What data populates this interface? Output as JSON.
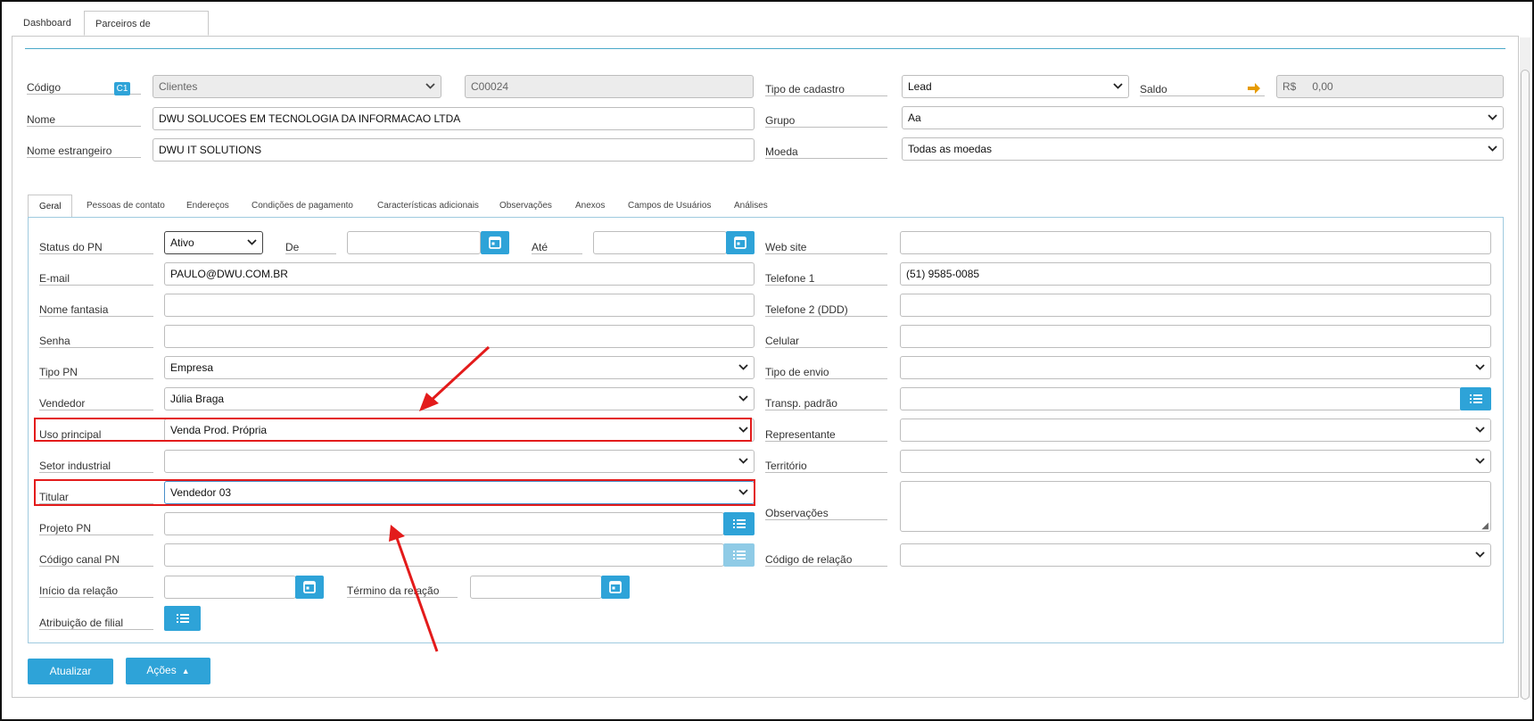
{
  "tabs": {
    "dashboard": "Dashboard",
    "partners": "Parceiros de negócios"
  },
  "header": {
    "codigo_label": "Código",
    "codigo_badge": "C1",
    "codigo_type": "Clientes",
    "codigo_value": "C00024",
    "nome_label": "Nome",
    "nome_value": "DWU SOLUCOES EM TECNOLOGIA DA INFORMACAO LTDA",
    "nome_estrangeiro_label": "Nome estrangeiro",
    "nome_estrangeiro_value": "DWU IT SOLUTIONS",
    "tipo_cadastro_label": "Tipo de cadastro",
    "tipo_cadastro_value": "Lead",
    "saldo_label": "Saldo",
    "saldo_currency": "R$",
    "saldo_value": "0,00",
    "grupo_label": "Grupo",
    "grupo_value": "Aa",
    "moeda_label": "Moeda",
    "moeda_value": "Todas as moedas"
  },
  "page_tabs": [
    "Geral",
    "Pessoas de contato",
    "Endereços",
    "Condições de pagamento",
    "Características adicionais",
    "Observações",
    "Anexos",
    "Campos de Usuários",
    "Análises"
  ],
  "form": {
    "status_label": "Status do PN",
    "status_value": "Ativo",
    "de_label": "De",
    "ate_label": "Até",
    "email_label": "E-mail",
    "email_value": "PAULO@DWU.COM.BR",
    "nome_fantasia_label": "Nome fantasia",
    "senha_label": "Senha",
    "tipo_pn_label": "Tipo PN",
    "tipo_pn_value": "Empresa",
    "vendedor_label": "Vendedor",
    "vendedor_value": "Júlia Braga",
    "uso_principal_label": "Uso principal",
    "uso_principal_value": "Venda Prod. Própria",
    "setor_label": "Setor industrial",
    "titular_label": "Titular",
    "titular_value": "Vendedor 03",
    "projeto_label": "Projeto PN",
    "canal_label": "Código canal PN",
    "inicio_label": "Início da relação",
    "termino_label": "Término da relação",
    "filial_label": "Atribuição de filial",
    "website_label": "Web site",
    "telefone1_label": "Telefone 1",
    "telefone1_value": "(51) 9585-0085",
    "telefone2_label": "Telefone 2 (DDD)",
    "celular_label": "Celular",
    "tipo_envio_label": "Tipo de envio",
    "transp_label": "Transp. padrão",
    "representante_label": "Representante",
    "territorio_label": "Território",
    "observacoes_label": "Observações",
    "codigo_relacao_label": "Código de relação"
  },
  "buttons": {
    "atualizar": "Atualizar",
    "acoes": "Ações"
  },
  "colors": {
    "accent": "#2ea3d8",
    "highlight": "#e31b1b",
    "arrow": "#e69b00"
  }
}
